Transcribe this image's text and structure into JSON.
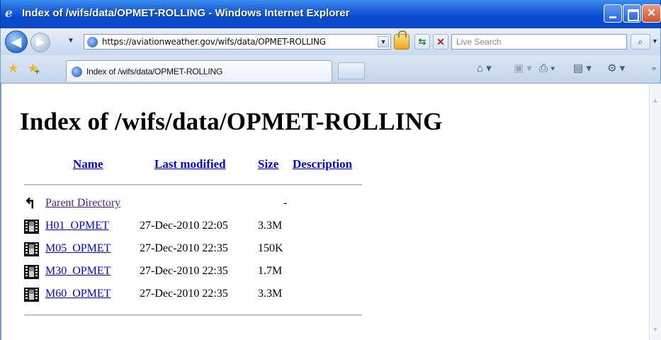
{
  "window": {
    "title": "Index of /wifs/data/OPMET-ROLLING - Windows Internet Explorer",
    "icon": "ie-logo-icon"
  },
  "toolbar": {
    "address": "https://aviationweather.gov/wifs/data/OPMET-ROLLING",
    "search_placeholder": "Live Search"
  },
  "tabs": [
    {
      "label": "Index of /wifs/data/OPMET-ROLLING"
    }
  ],
  "page": {
    "title": "Index of /wifs/data/OPMET-ROLLING",
    "columns": {
      "name": "Name",
      "last_modified": "Last modified",
      "size": "Size",
      "description": "Description"
    },
    "parent": {
      "label": "Parent Directory",
      "size": "-"
    },
    "files": [
      {
        "name": "H01_OPMET",
        "modified": "27-Dec-2010 22:05",
        "size": "3.3M"
      },
      {
        "name": "M05_OPMET",
        "modified": "27-Dec-2010 22:35",
        "size": "150K"
      },
      {
        "name": "M30_OPMET",
        "modified": "27-Dec-2010 22:35",
        "size": "1.7M"
      },
      {
        "name": "M60_OPMET",
        "modified": "27-Dec-2010 22:35",
        "size": "3.3M"
      }
    ]
  }
}
